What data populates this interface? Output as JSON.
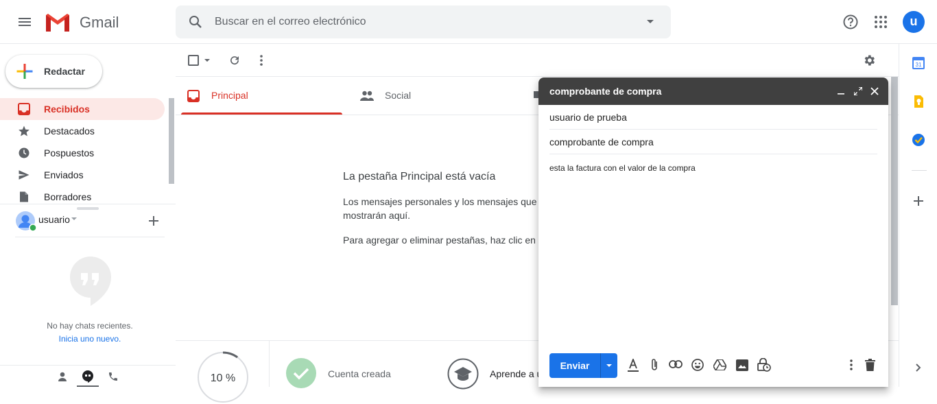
{
  "header": {
    "app_name": "Gmail",
    "search_placeholder": "Buscar en el correo electrónico",
    "avatar_letter": "u"
  },
  "sidebar": {
    "compose_label": "Redactar",
    "items": [
      {
        "label": "Recibidos",
        "icon": "inbox-icon",
        "active": true
      },
      {
        "label": "Destacados",
        "icon": "star-icon"
      },
      {
        "label": "Pospuestos",
        "icon": "clock-icon"
      },
      {
        "label": "Enviados",
        "icon": "send-icon"
      },
      {
        "label": "Borradores",
        "icon": "draft-icon"
      }
    ]
  },
  "hangouts": {
    "user_name": "usuario",
    "no_chats": "No hay chats recientes.",
    "start_new": "Inicia uno nuevo."
  },
  "tabs": [
    {
      "label": "Principal",
      "active": true,
      "icon": "inbox-tab-icon"
    },
    {
      "label": "Social",
      "icon": "people-icon"
    }
  ],
  "empty_state": {
    "title": "La pestaña Principal está vacía",
    "line1": "Los mensajes personales y los mensajes que",
    "line2": "mostrarán aquí.",
    "line3": "Para agregar o eliminar pestañas, haz clic en C"
  },
  "setup": {
    "progress": "10 %",
    "progress_fraction": 0.1,
    "account_created": "Cuenta creada",
    "learn": "Aprende a u"
  },
  "compose": {
    "title": "comprobante de compra",
    "to": "usuario de prueba",
    "subject": "comprobante de compra",
    "body": "esta la factura con el valor de la compra",
    "send_label": "Enviar"
  },
  "colors": {
    "accent_red": "#d93025",
    "send_blue": "#1a73e8",
    "compose_header": "#404040"
  }
}
